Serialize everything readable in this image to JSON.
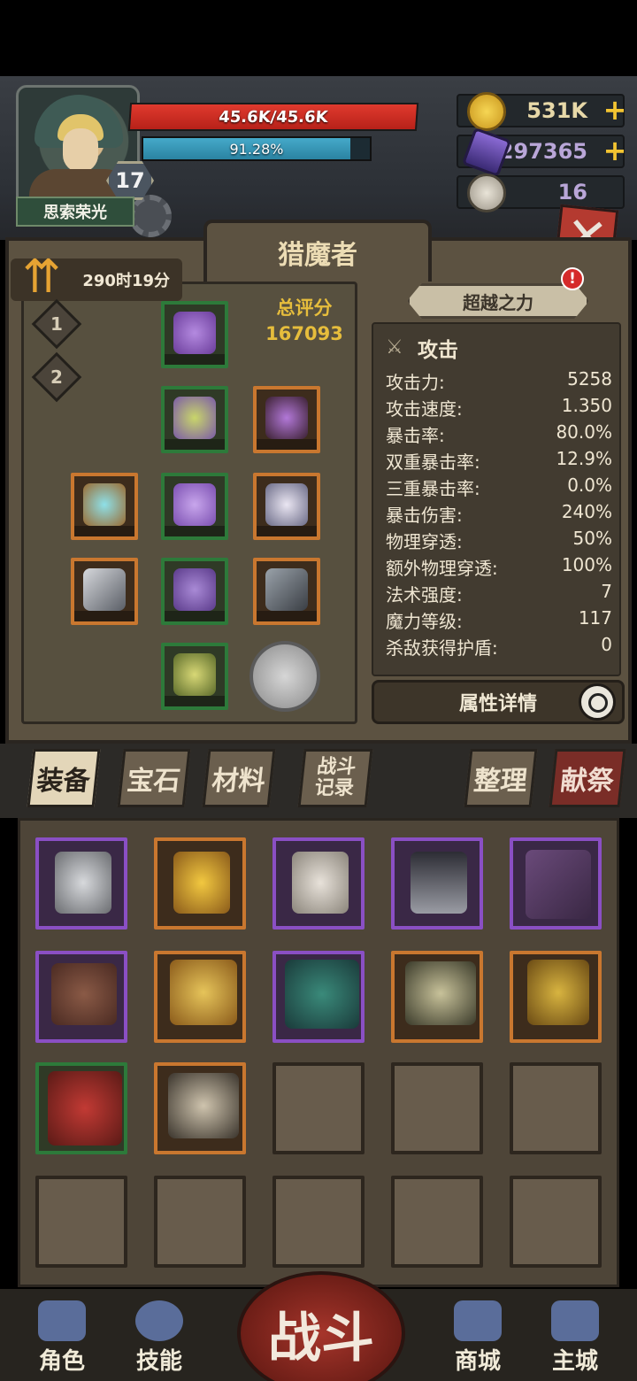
{
  "player": {
    "name": "思索荣光",
    "level": "17",
    "hp_text": "45.6K/45.6K",
    "hp_fraction": 1.0,
    "mp_text": "91.28%",
    "mp_fraction": 0.9128
  },
  "resources": {
    "gold": "531K",
    "crystals": "297365",
    "skulls": "16"
  },
  "panel": {
    "title": "猎魔者",
    "timer": "290时19分",
    "tiers": [
      "1",
      "2"
    ],
    "score_label": "总评分",
    "score_value": "167093",
    "super_power_label": "超越之力"
  },
  "stats": {
    "header": "攻击",
    "rows": [
      {
        "label": "攻击力:",
        "value": "5258"
      },
      {
        "label": "攻击速度:",
        "value": "1.350"
      },
      {
        "label": "暴击率:",
        "value": "80.0%"
      },
      {
        "label": "双重暴击率:",
        "value": "12.9%"
      },
      {
        "label": "三重暴击率:",
        "value": "0.0%"
      },
      {
        "label": "暴击伤害:",
        "value": "240%"
      },
      {
        "label": "物理穿透:",
        "value": "50%"
      },
      {
        "label": "额外物理穿透:",
        "value": "100%"
      },
      {
        "label": "法术强度:",
        "value": "7"
      },
      {
        "label": "魔力等级:",
        "value": "117"
      },
      {
        "label": "杀敌获得护盾:",
        "value": "0"
      }
    ],
    "detail_button": "属性详情"
  },
  "tabs": {
    "equipment": "装备",
    "gems": "宝石",
    "materials": "材料",
    "battle_log": "战斗记录",
    "sort": "整理",
    "sacrifice": "献祭"
  },
  "nav": {
    "character": "角色",
    "skills": "技能",
    "battle": "战斗",
    "shop": "商城",
    "city": "主城"
  },
  "colors": {
    "rarity_green": "#2d7a3a",
    "rarity_orange": "#c9772f",
    "rarity_purple": "#8a4fc4",
    "hp_red": "#d5302a",
    "mp_blue": "#3a98b8",
    "gold_text": "#e6bd3c"
  }
}
